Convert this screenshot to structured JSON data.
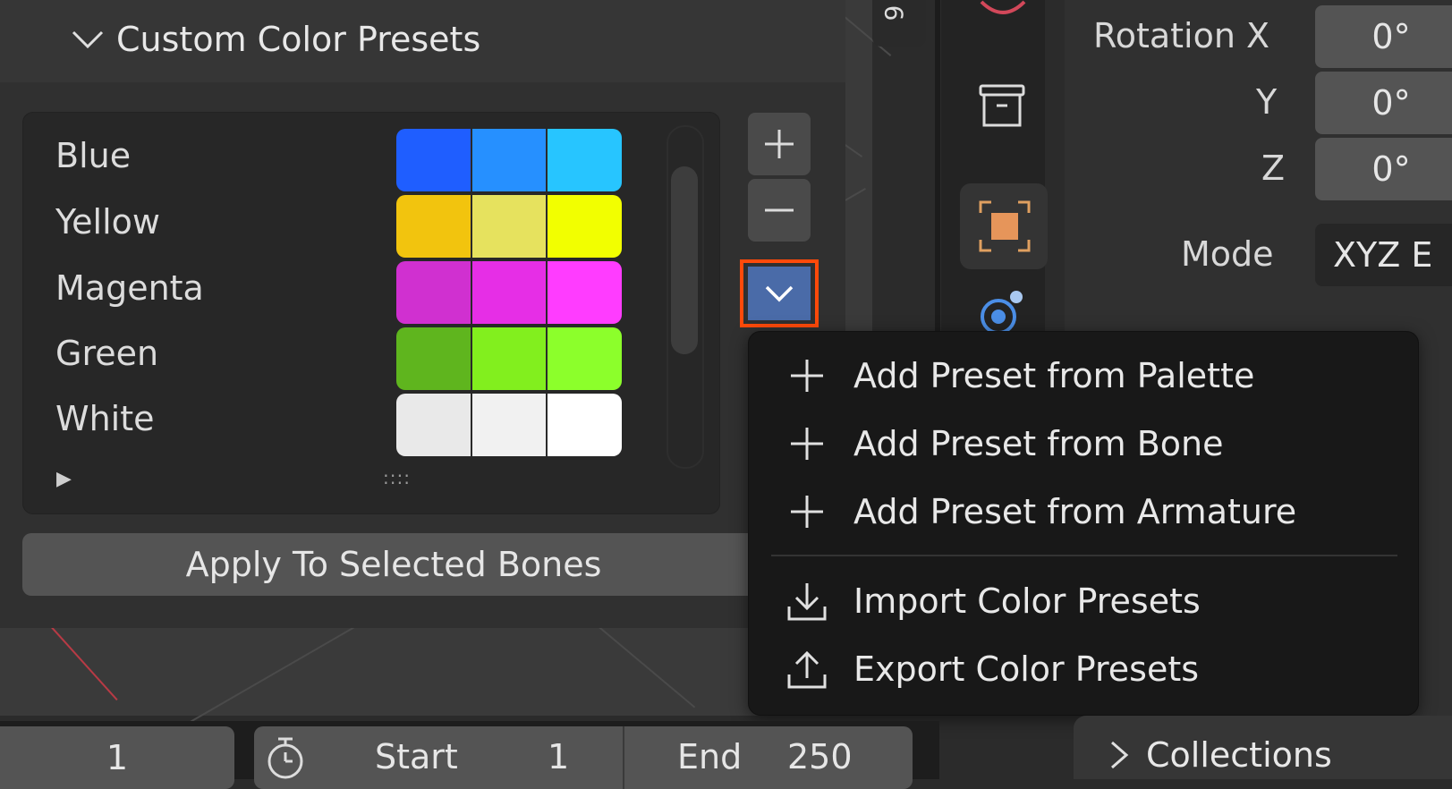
{
  "panel": {
    "title": "Custom Color Presets",
    "presets": [
      {
        "name": "Blue",
        "colors": [
          "#1f5eff",
          "#2690ff",
          "#27c5ff"
        ]
      },
      {
        "name": "Yellow",
        "colors": [
          "#f2c40e",
          "#e6e25e",
          "#f2ff00"
        ]
      },
      {
        "name": "Magenta",
        "colors": [
          "#d030d0",
          "#e62ee6",
          "#ff3cff"
        ]
      },
      {
        "name": "Green",
        "colors": [
          "#5fb51e",
          "#82ef1e",
          "#8cff2b"
        ]
      },
      {
        "name": "White",
        "colors": [
          "#e9e9e9",
          "#f1f1f1",
          "#ffffff"
        ]
      }
    ],
    "expand_arrow": "▶",
    "grip": "::::",
    "apply_label": "Apply To Selected Bones"
  },
  "menu": {
    "items": [
      {
        "label": "Add Preset from Palette",
        "icon": "plus-icon"
      },
      {
        "label": "Add Preset from Bone",
        "icon": "plus-icon"
      },
      {
        "label": "Add Preset from Armature",
        "icon": "plus-icon"
      },
      {
        "label": "Import Color Presets",
        "icon": "import-icon"
      },
      {
        "label": "Export Color Presets",
        "icon": "export-icon"
      }
    ]
  },
  "properties": {
    "rotation_x_label": "Rotation X",
    "rotation_x_value": "0°",
    "y_label": "Y",
    "y_value": "0°",
    "z_label": "Z",
    "z_value": "0°",
    "mode_label": "Mode",
    "mode_value": "XYZ E"
  },
  "sidebar_tab": "6",
  "timeline": {
    "frame": "1",
    "start_label": "Start",
    "start_value": "1",
    "end_label": "End",
    "end_value": "250"
  },
  "outliner": {
    "collections_label": "Collections"
  },
  "colors": {
    "highlight": "#ff4a0a",
    "dropdown_button": "#4a6ba8"
  }
}
